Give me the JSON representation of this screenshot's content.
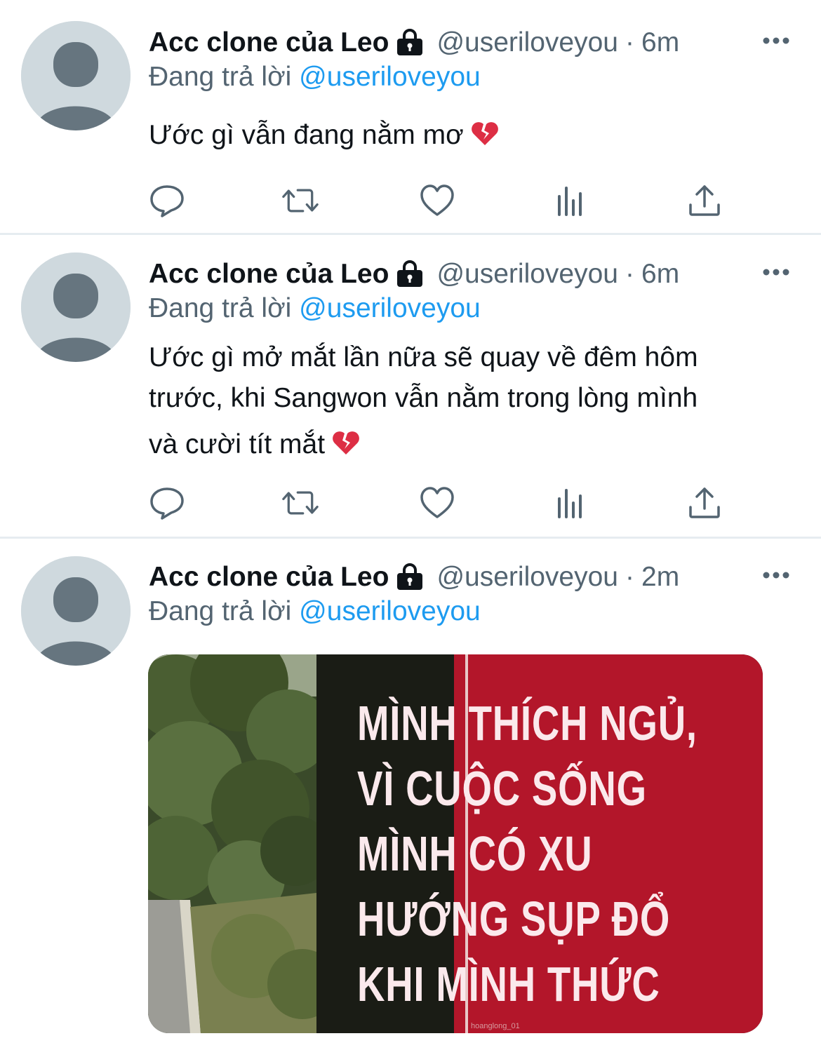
{
  "tweets": [
    {
      "name": "Acc clone của Leo",
      "handle": "@useriloveyou",
      "separator": "·",
      "time": "6m",
      "reply_prefix": "Đang trả lời",
      "reply_mention": "@useriloveyou",
      "text": "Ước gì vẫn đang nằm mơ",
      "emoji": "broken-heart-icon"
    },
    {
      "name": "Acc clone của Leo",
      "handle": "@useriloveyou",
      "separator": "·",
      "time": "6m",
      "reply_prefix": "Đang trả lời",
      "reply_mention": "@useriloveyou",
      "text_lines": [
        "Ước gì mở mắt lần nữa sẽ quay về đêm hôm",
        "trước, khi Sangwon vẫn nằm trong lòng mình",
        "và cười tít mắt"
      ],
      "emoji": "broken-heart-icon"
    },
    {
      "name": "Acc clone của Leo",
      "handle": "@useriloveyou",
      "separator": "·",
      "time": "2m",
      "reply_prefix": "Đang trả lời",
      "reply_mention": "@useriloveyou",
      "media": {
        "sign_lines": [
          "MÌNH THÍCH NGỦ,",
          "VÌ CUỘC SỐNG",
          "MÌNH CÓ XU",
          "HƯỚNG SỤP ĐỔ",
          "KHI MÌNH THỨC"
        ],
        "watermark": "hoanglong_01"
      }
    }
  ],
  "colors": {
    "text": "#0f1419",
    "secondary": "#536471",
    "accent": "#1d9bf0",
    "divider": "#e6ecf0",
    "avatar_bg": "#cfd9de",
    "avatar_fg": "#7a8a99",
    "sign_red": "#b3162a"
  }
}
